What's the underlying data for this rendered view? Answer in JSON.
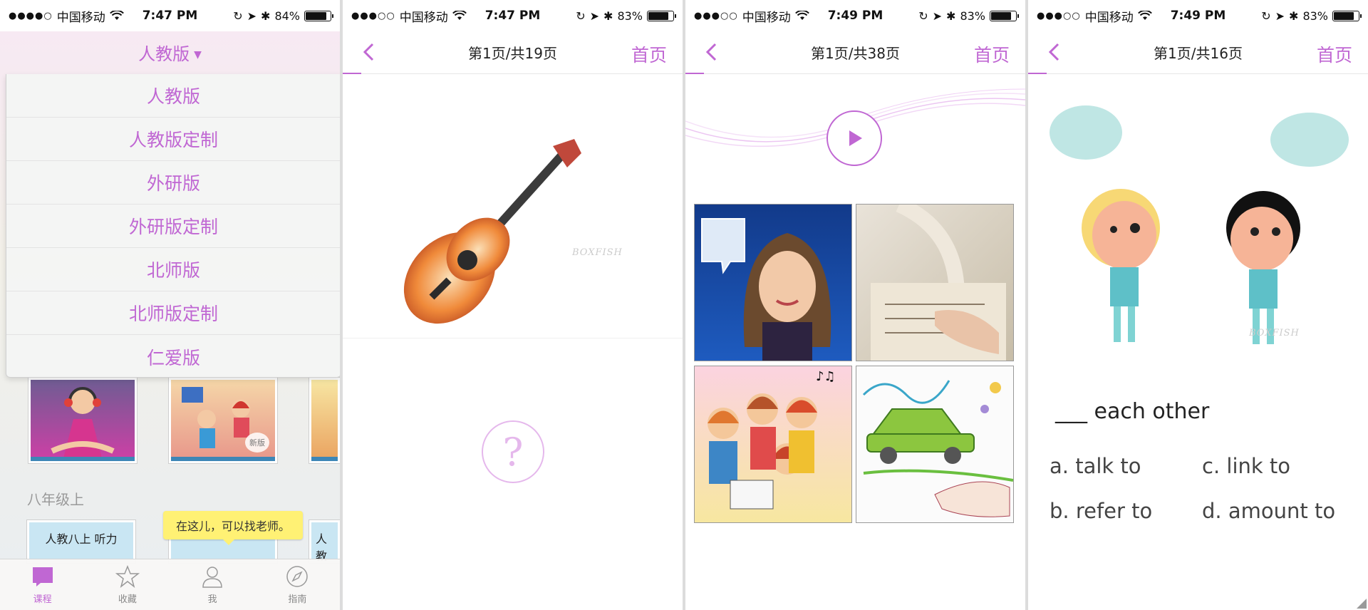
{
  "status_bars": [
    {
      "dots": "●●●●○",
      "carrier": "中国移动",
      "time": "7:47 PM",
      "battery_text": "84%",
      "battery_level": 0.84
    },
    {
      "dots": "●●●○○",
      "carrier": "中国移动",
      "time": "7:47 PM",
      "battery_text": "83%",
      "battery_level": 0.83
    },
    {
      "dots": "●●●○○",
      "carrier": "中国移动",
      "time": "7:49 PM",
      "battery_text": "83%",
      "battery_level": 0.83
    },
    {
      "dots": "●●●○○",
      "carrier": "中国移动",
      "time": "7:49 PM",
      "battery_text": "83%",
      "battery_level": 0.83
    }
  ],
  "screen1": {
    "title": "人教版",
    "caret": "▼",
    "dropdown_options": [
      "人教版",
      "人教版定制",
      "外研版",
      "外研版定制",
      "北师版",
      "北师版定制",
      "仁爱版"
    ],
    "new_badge": "新版",
    "grade_label": "八年级上",
    "book_title": "人教八上 听力",
    "book_partial": "人教",
    "tooltip": "在这儿，可以找老师。",
    "tabs": [
      {
        "label": "课程",
        "icon": "course-icon",
        "active": true
      },
      {
        "label": "收藏",
        "icon": "star-icon",
        "active": false
      },
      {
        "label": "我",
        "icon": "person-icon",
        "active": false
      },
      {
        "label": "指南",
        "icon": "compass-icon",
        "active": false
      }
    ]
  },
  "screen2": {
    "page_indicator": "第1页/共19页",
    "home": "首页",
    "watermark": "BOXFISH",
    "answer_symbol": "?"
  },
  "screen3": {
    "page_indicator": "第1页/共38页",
    "home": "首页"
  },
  "screen4": {
    "page_indicator": "第1页/共16页",
    "home": "首页",
    "watermark": "BOXFISH",
    "question": "___ each other",
    "options": [
      "a. talk to",
      "c. link to",
      "b. refer to",
      "d. amount to"
    ]
  },
  "colors": {
    "accent": "#c067d3",
    "tooltip": "#fff174",
    "bubble": "#bfe6e4"
  }
}
